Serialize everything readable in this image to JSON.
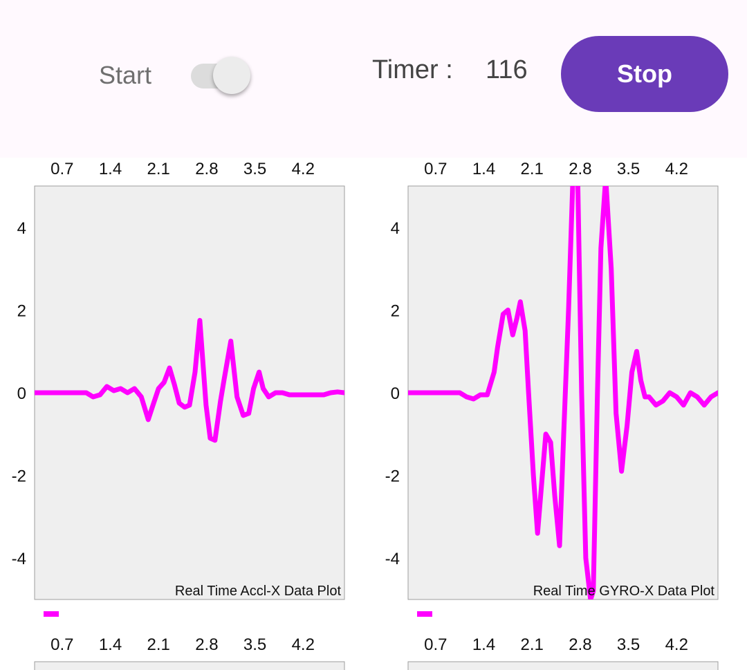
{
  "controls": {
    "start_label": "Start",
    "switch_on": true,
    "timer_label": "Timer :",
    "timer_value": "116",
    "stop_label": "Stop",
    "accent_color": "#6a3bb8"
  },
  "chart_data": [
    {
      "type": "line",
      "title": "Real Time Accl-X Data Plot",
      "xlim": [
        0.3,
        4.8
      ],
      "ylim": [
        -5,
        5
      ],
      "x_ticks": [
        "0.7",
        "1.4",
        "2.1",
        "2.8",
        "3.5",
        "4.2"
      ],
      "y_ticks": [
        "4",
        "2",
        "0",
        "-2",
        "-4"
      ],
      "line_color": "#ff00ff",
      "background": "#efefef",
      "legend_swatch_color": "#ff00ff",
      "series": [
        {
          "x": [
            0.3,
            0.5,
            0.7,
            0.9,
            1.05,
            1.15,
            1.25,
            1.35,
            1.45,
            1.55,
            1.65,
            1.75,
            1.85,
            1.95,
            2.02,
            2.1,
            2.18,
            2.26,
            2.33,
            2.4,
            2.48,
            2.55,
            2.63,
            2.7,
            2.79,
            2.85,
            2.92,
            3.0,
            3.05,
            3.15,
            3.24,
            3.33,
            3.41,
            3.48,
            3.56,
            3.62,
            3.7,
            3.8,
            3.9,
            4.0,
            4.1,
            4.2,
            4.3,
            4.4,
            4.5,
            4.6,
            4.7,
            4.8
          ],
          "y": [
            0,
            0,
            0,
            0,
            0,
            -0.1,
            -0.05,
            0.15,
            0.05,
            0.1,
            0,
            0.1,
            -0.1,
            -0.65,
            -0.3,
            0.1,
            0.25,
            0.6,
            0.2,
            -0.25,
            -0.35,
            -0.3,
            0.5,
            1.75,
            -0.3,
            -1.1,
            -1.15,
            -0.2,
            0.3,
            1.25,
            -0.1,
            -0.55,
            -0.5,
            0.1,
            0.5,
            0.1,
            -0.1,
            0,
            0,
            -0.05,
            -0.05,
            -0.05,
            -0.05,
            -0.05,
            -0.05,
            0,
            0.02,
            0
          ]
        }
      ]
    },
    {
      "type": "line",
      "title": "Real Time GYRO-X Data Plot",
      "xlim": [
        0.3,
        4.8
      ],
      "ylim": [
        -5,
        5
      ],
      "x_ticks": [
        "0.7",
        "1.4",
        "2.1",
        "2.8",
        "3.5",
        "4.2"
      ],
      "y_ticks": [
        "4",
        "2",
        "0",
        "-2",
        "-4"
      ],
      "line_color": "#ff00ff",
      "background": "#efefef",
      "legend_swatch_color": "#ff00ff",
      "series": [
        {
          "x": [
            0.3,
            0.5,
            0.7,
            0.9,
            1.05,
            1.15,
            1.25,
            1.35,
            1.45,
            1.55,
            1.6,
            1.68,
            1.75,
            1.82,
            1.88,
            1.93,
            2.0,
            2.05,
            2.12,
            2.18,
            2.25,
            2.3,
            2.37,
            2.43,
            2.5,
            2.56,
            2.63,
            2.7,
            2.76,
            2.82,
            2.88,
            2.95,
            2.99,
            3.05,
            3.1,
            3.17,
            3.25,
            3.32,
            3.4,
            3.48,
            3.55,
            3.62,
            3.68,
            3.74,
            3.8,
            3.9,
            4.0,
            4.1,
            4.2,
            4.3,
            4.4,
            4.5,
            4.6,
            4.7,
            4.8
          ],
          "y": [
            0,
            0,
            0,
            0,
            0,
            -0.1,
            -0.15,
            -0.05,
            -0.05,
            0.5,
            1.1,
            1.9,
            2.0,
            1.4,
            1.8,
            2.2,
            1.5,
            0,
            -2.0,
            -3.4,
            -2.0,
            -1.0,
            -1.2,
            -2.5,
            -3.7,
            -1.0,
            2.0,
            5.5,
            5.5,
            0,
            -4.0,
            -5.0,
            -4.8,
            0,
            3.5,
            5.2,
            3.0,
            -0.5,
            -1.9,
            -0.8,
            0.5,
            1.0,
            0.3,
            -0.1,
            -0.1,
            -0.3,
            -0.2,
            0,
            -0.1,
            -0.3,
            0,
            -0.1,
            -0.3,
            -0.1,
            0
          ]
        }
      ]
    }
  ]
}
